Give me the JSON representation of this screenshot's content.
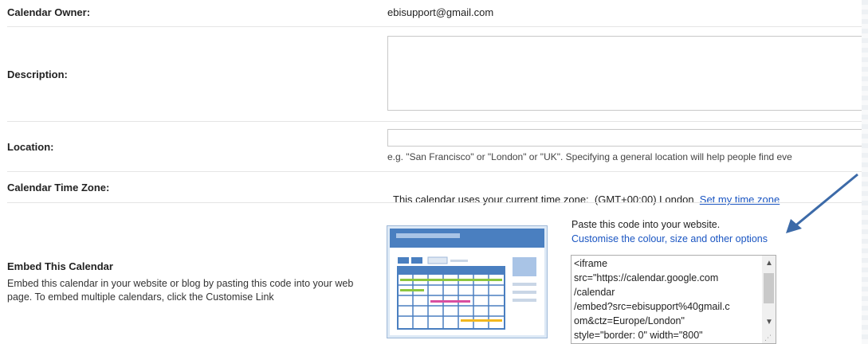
{
  "owner": {
    "label": "Calendar Owner:",
    "value": "ebisupport@gmail.com"
  },
  "description": {
    "label": "Description:"
  },
  "location": {
    "label": "Location:",
    "hint": "e.g. \"San Francisco\" or \"London\" or \"UK\". Specifying a general location will help people find eve"
  },
  "timezone": {
    "label": "Calendar Time Zone:",
    "text": "This calendar uses your current time zone:  (GMT+00:00) London",
    "link": "Set my time zone"
  },
  "embed": {
    "title": "Embed This Calendar",
    "description": "Embed this calendar in your website or blog by pasting this code into your web page. To embed multiple calendars, click the Customise Link",
    "paste_text": "Paste this code into your website.",
    "customise_link": "Customise the colour, size and other options",
    "code": "<iframe\nsrc=\"https://calendar.google.com\n/calendar\n/embed?src=ebisupport%40gmail.c\nom&ctz=Europe/London\"\nstyle=\"border: 0\" width=\"800\""
  },
  "colors": {
    "link": "#1a55c2",
    "arrow": "#3c6aa8",
    "illustration_blue": "#4a7fc0"
  },
  "icons": [
    "calendar-illustration",
    "scroll-up-icon",
    "scroll-down-icon",
    "resize-grip-icon",
    "annotation-arrow-icon"
  ]
}
